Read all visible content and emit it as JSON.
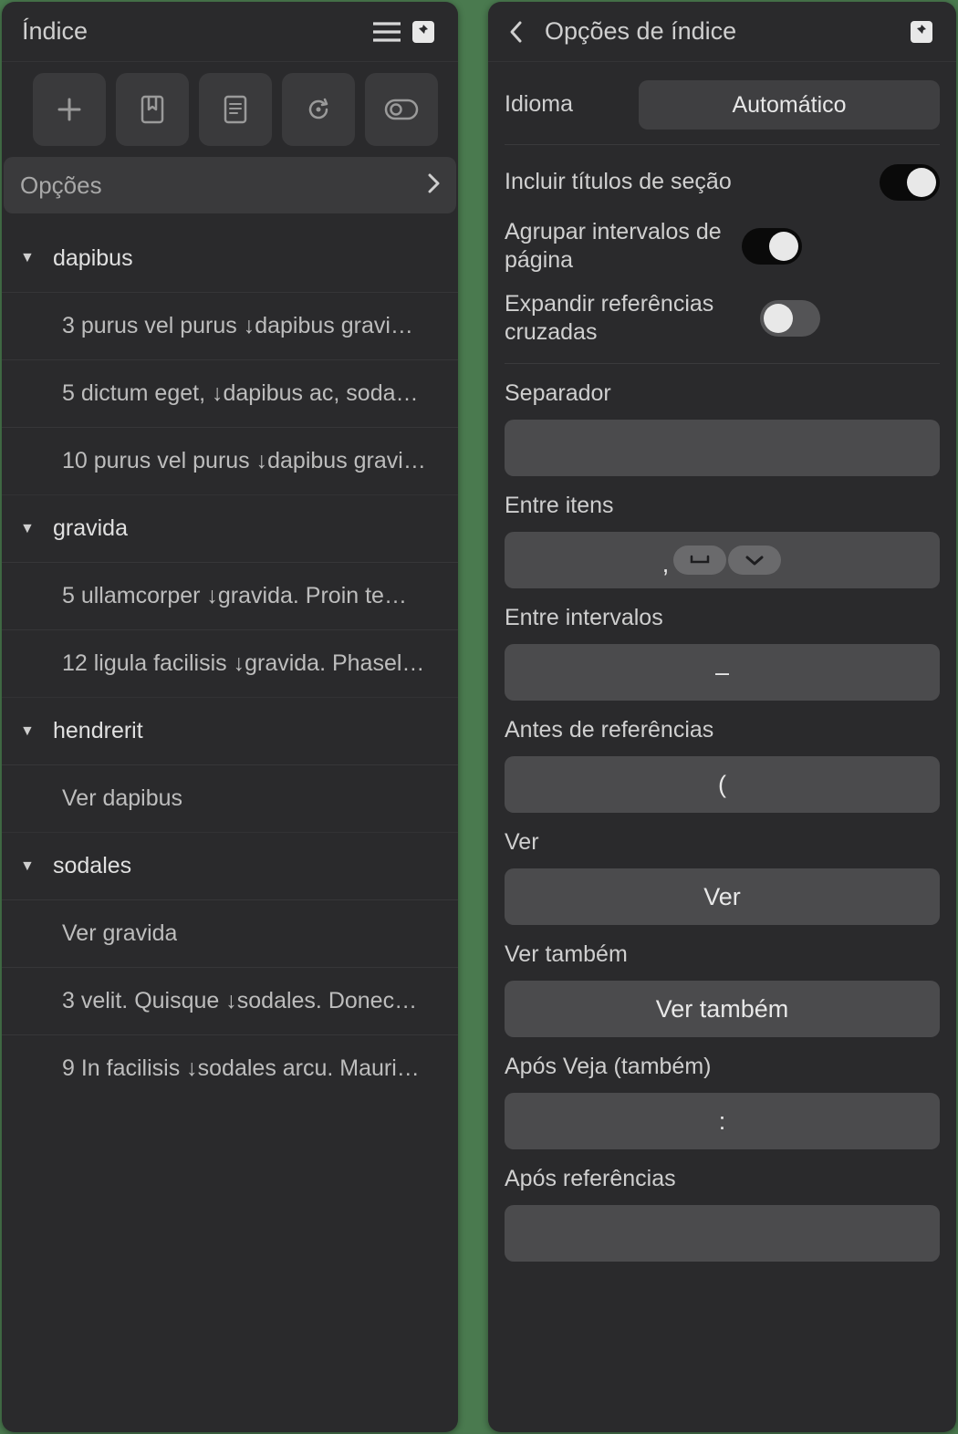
{
  "left": {
    "title": "Índice",
    "options_label": "Opções",
    "groups": [
      {
        "name": "dapibus",
        "items": [
          "3 purus vel purus ↓dapibus gravi…",
          "5 dictum eget, ↓dapibus ac, soda…",
          "10 purus vel purus ↓dapibus gravi…"
        ]
      },
      {
        "name": "gravida",
        "items": [
          "5 ullamcorper ↓gravida. Proin te…",
          "12 ligula facilisis ↓gravida. Phasel…"
        ]
      },
      {
        "name": "hendrerit",
        "items": [
          "Ver dapibus"
        ]
      },
      {
        "name": "sodales",
        "items": [
          "Ver gravida",
          "3 velit. Quisque ↓sodales. Donec…",
          "9 In facilisis ↓sodales arcu. Mauri…"
        ]
      }
    ]
  },
  "right": {
    "title": "Opções de índice",
    "language_label": "Idioma",
    "language_value": "Automático",
    "toggles": {
      "include_section_titles": {
        "label": "Incluir títulos de seção",
        "on": true
      },
      "group_page_ranges": {
        "label": "Agrupar intervalos de página",
        "on": true
      },
      "expand_cross_refs": {
        "label": "Expandir referências cruzadas",
        "on": false
      }
    },
    "fields": {
      "separator": {
        "label": "Separador",
        "value": ""
      },
      "between_items": {
        "label": "Entre itens",
        "prefix": ","
      },
      "between_ranges": {
        "label": "Entre intervalos",
        "value": "–"
      },
      "before_refs": {
        "label": "Antes de referências",
        "value": "("
      },
      "see": {
        "label": "Ver",
        "value": "Ver"
      },
      "see_also": {
        "label": "Ver também",
        "value": "Ver também"
      },
      "after_see": {
        "label": "Após Veja (também)",
        "value": ":"
      },
      "after_refs": {
        "label": "Após referências",
        "value": ""
      }
    }
  }
}
